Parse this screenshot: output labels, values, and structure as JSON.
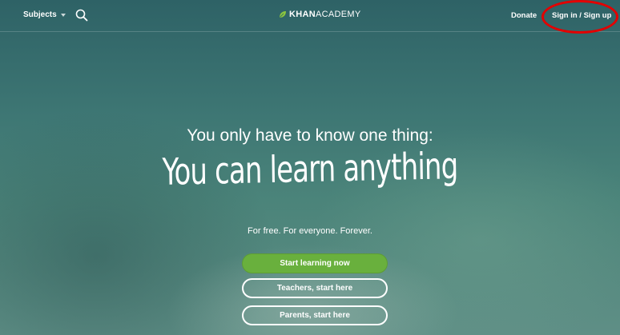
{
  "header": {
    "subjects_label": "Subjects",
    "logo_strong": "KHAN",
    "logo_rest": "ACADEMY",
    "donate_label": "Donate",
    "signin_label": "Sign in / Sign up"
  },
  "hero": {
    "tagline": "You only have to know one thing:",
    "headline": "You can learn anything",
    "subline": "For free. For everyone. Forever."
  },
  "actions": {
    "start_label": "Start learning now",
    "teachers_label": "Teachers, start here",
    "parents_label": "Parents, start here"
  },
  "icons": {
    "search": "search-icon",
    "subjects_caret": "chevron-down-icon",
    "logo_leaf": "leaf-icon"
  },
  "colors": {
    "primary_button": "#69b03d",
    "annotation_circle": "#e30000",
    "logo_leaf": "#8cc63f"
  }
}
